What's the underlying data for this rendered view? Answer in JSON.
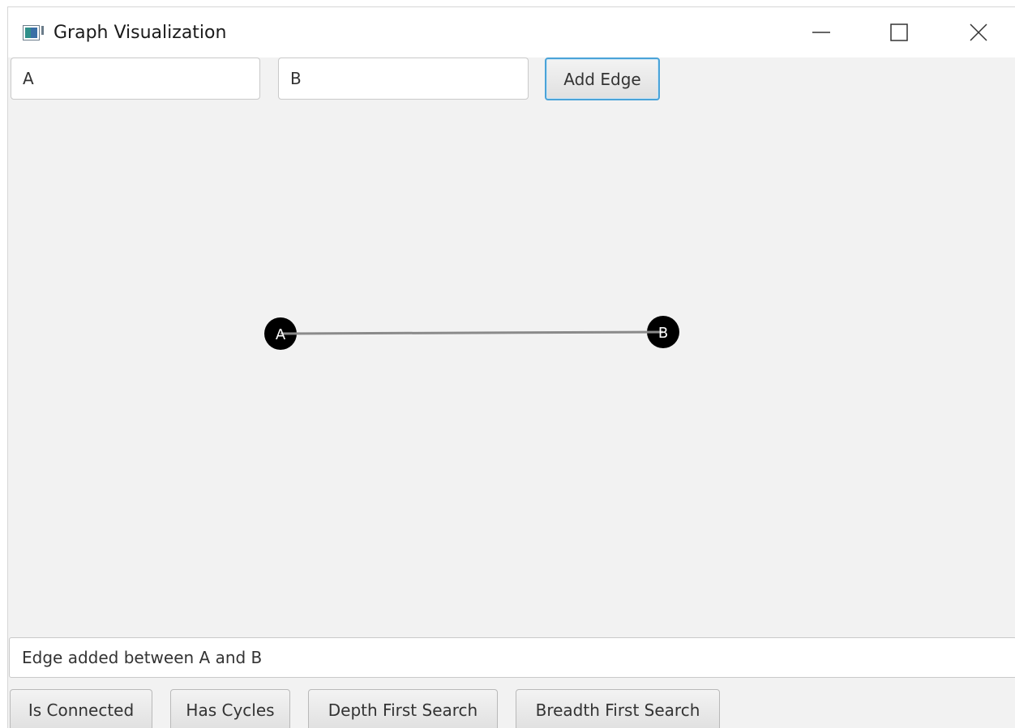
{
  "window": {
    "title": "Graph Visualization",
    "app_icon": "java-app-icon",
    "controls": [
      "minimize-icon",
      "maximize-icon",
      "close-icon"
    ]
  },
  "toolbar": {
    "vertex_a_value": "A",
    "vertex_b_value": "B",
    "add_edge_label": "Add Edge"
  },
  "graph": {
    "nodes": [
      {
        "id": "A",
        "label": "A"
      },
      {
        "id": "B",
        "label": "B"
      }
    ],
    "edges": [
      {
        "from": "A",
        "to": "B"
      }
    ],
    "colors": {
      "node_fill": "#000000",
      "node_text": "#ffffff",
      "edge": "#8a8a8a",
      "focus_accent": "#4aa3d8"
    }
  },
  "status": {
    "message": "Edge added between A and B"
  },
  "actions": {
    "is_connected_label": "Is Connected",
    "has_cycles_label": "Has Cycles",
    "dfs_label": "Depth First Search",
    "bfs_label": "Breadth First Search"
  }
}
